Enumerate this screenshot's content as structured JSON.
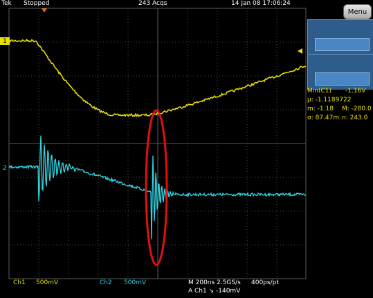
{
  "header": {
    "brand": "Tek",
    "acq_state": "Stopped",
    "acq_count": "243 Acqs",
    "timestamp": "14 Jan 08 17:06:24"
  },
  "menu": {
    "label": "Menu"
  },
  "channels": {
    "ch1": {
      "marker": "1",
      "name": "Ch1",
      "scale": "500mV",
      "color": "#e8e000"
    },
    "ch2": {
      "marker": "2",
      "name": "Ch2",
      "scale": "500mV",
      "color": "#2fd8e6"
    }
  },
  "measurements": {
    "label_min": "Min(C1)",
    "value_min": "-1.16V",
    "mu": "µ: -1.1189722",
    "m": "m: -1.18",
    "M": "M: -280.0",
    "sigma": "σ: 87.47m",
    "n": "n: 243.0"
  },
  "status": {
    "timebase": "M 200ns 2.5GS/s",
    "resolution": "400ps/pt",
    "trigger": "A  Ch1  ↘  -140mV"
  },
  "colors": {
    "background": "#000000",
    "grid": "#505050",
    "ch1": "#e8e000",
    "ch2": "#2fd8e6",
    "highlight_ellipse": "#e01010",
    "side_panel": "#2e5d8c"
  },
  "icons": {
    "trigger_position": "orange-triangle-marker",
    "trigger_level": "yellow-arrow-marker"
  }
}
